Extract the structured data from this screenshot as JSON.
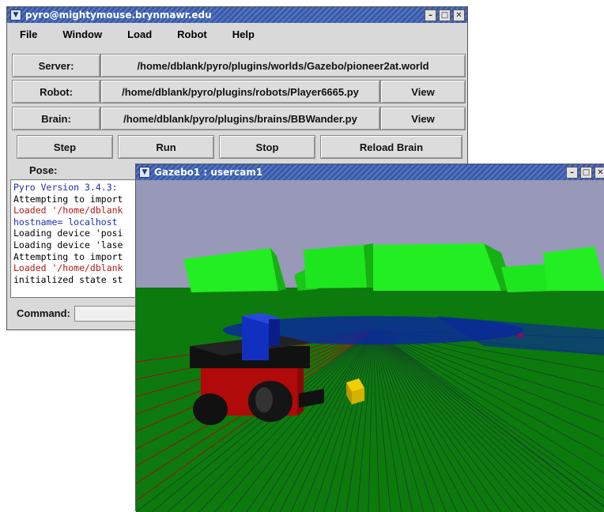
{
  "pyro_window": {
    "title": "pyro@mightymouse.brynmawr.edu",
    "menu": [
      "File",
      "Window",
      "Load",
      "Robot",
      "Help"
    ],
    "server_label": "Server:",
    "server_value": "/home/dblank/pyro/plugins/worlds/Gazebo/pioneer2at.world",
    "robot_label": "Robot:",
    "robot_value": "/home/dblank/pyro/plugins/robots/Player6665.py",
    "brain_label": "Brain:",
    "brain_value": "/home/dblank/pyro/plugins/brains/BBWander.py",
    "view_label": "View",
    "step_label": "Step",
    "run_label": "Run",
    "stop_label": "Stop",
    "reload_label": "Reload Brain",
    "pose_label": "Pose:",
    "command_label": "Command:",
    "console_lines": [
      {
        "text": "Pyro Version 3.4.3:",
        "color": "#1a2fb0"
      },
      {
        "text": "Attempting to import",
        "color": "#000000"
      },
      {
        "text": "Loaded '/home/dblank",
        "color": "#b01818"
      },
      {
        "text": "hostname= localhost",
        "color": "#1a2fb0"
      },
      {
        "text": "Loading device 'posi",
        "color": "#000000"
      },
      {
        "text": "Loading device 'lase",
        "color": "#000000"
      },
      {
        "text": "Attempting to import",
        "color": "#000000"
      },
      {
        "text": "Loaded '/home/dblank",
        "color": "#b01818"
      },
      {
        "text": "initialized state st",
        "color": "#000000"
      }
    ]
  },
  "gazebo_window": {
    "title": "Gazebo1 : usercam1"
  },
  "colors": {
    "title_bar": "#3a5aa8",
    "sky": "#9898b8",
    "ground": "#0d7a0d",
    "laser_green": "#114d22",
    "laser_red": "#a01010",
    "wall_green": "#22ee22",
    "robot_body": "#b00a0a",
    "robot_top": "#1230c0",
    "target_box": "#d4b200"
  }
}
